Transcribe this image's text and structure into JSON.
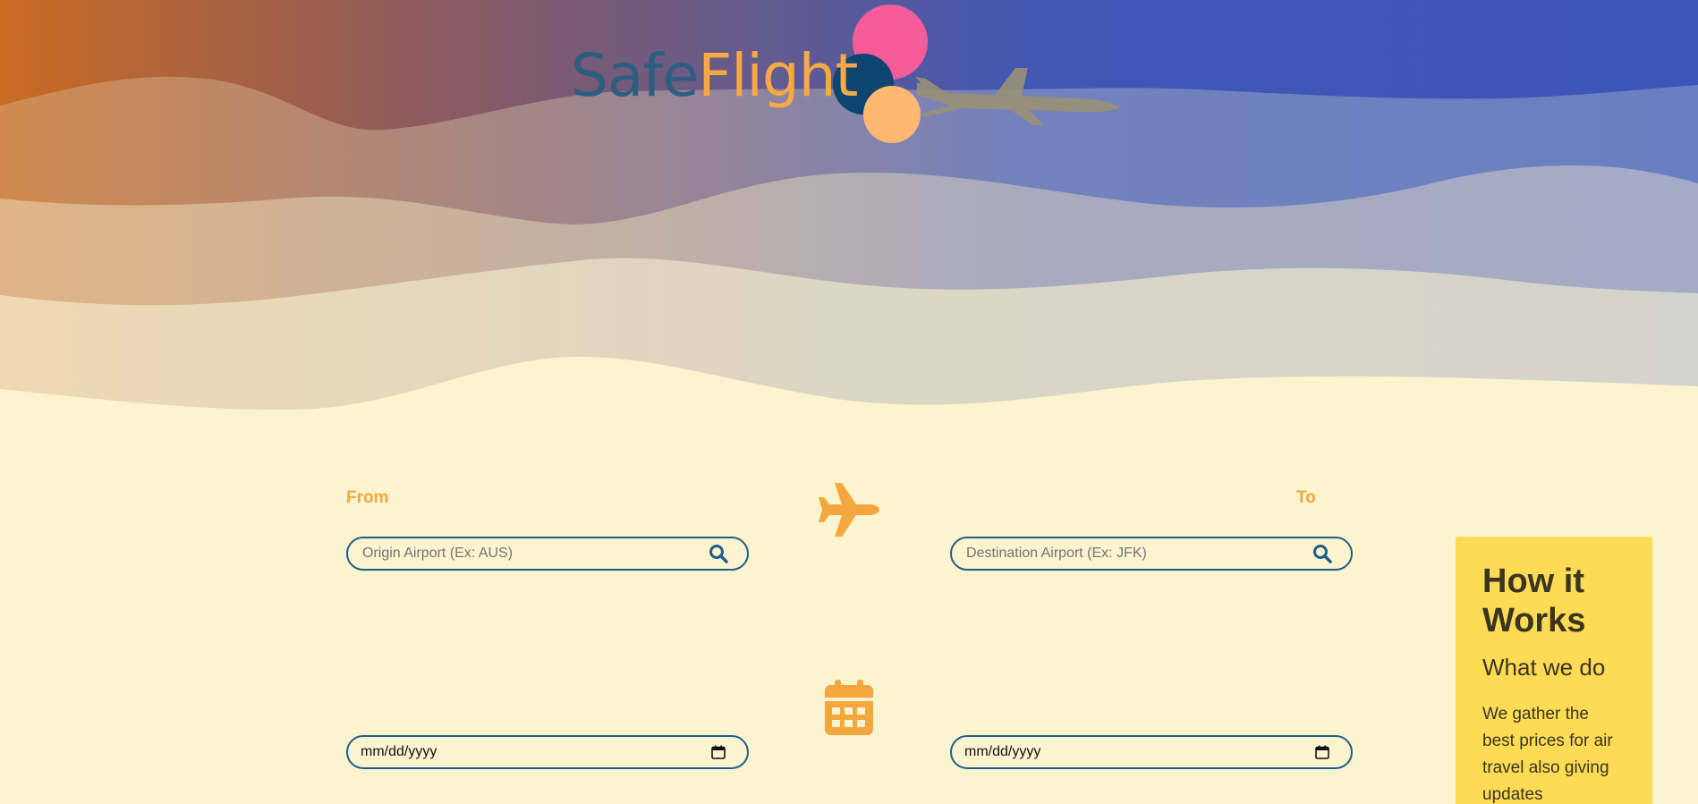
{
  "brand": {
    "part1": "Safe",
    "part2": "Flight"
  },
  "colors": {
    "background": "#fcf3cf",
    "accent_orange": "#f3a73c",
    "field_border": "#1f5e8c",
    "card_yellow": "#fedb55",
    "logo_blue": "#2c5e82",
    "logo_orange": "#f7a945"
  },
  "search": {
    "from_label": "From",
    "to_label": "To",
    "origin_placeholder": "Origin Airport (Ex: AUS)",
    "destination_placeholder": "Destination Airport (Ex: JFK)",
    "origin_value": "",
    "destination_value": "",
    "search_icon": "search-icon",
    "route_icon": "airplane-icon"
  },
  "dates": {
    "depart_placeholder": "mm/dd/yyyy",
    "return_placeholder": "mm/dd/yyyy",
    "date_icon": "calendar-icon",
    "picker_icon": "calendar-picker-icon"
  },
  "info_card": {
    "title": "How it Works",
    "subtitle": "What we do",
    "body": "We gather the best prices for air travel also giving updates"
  }
}
